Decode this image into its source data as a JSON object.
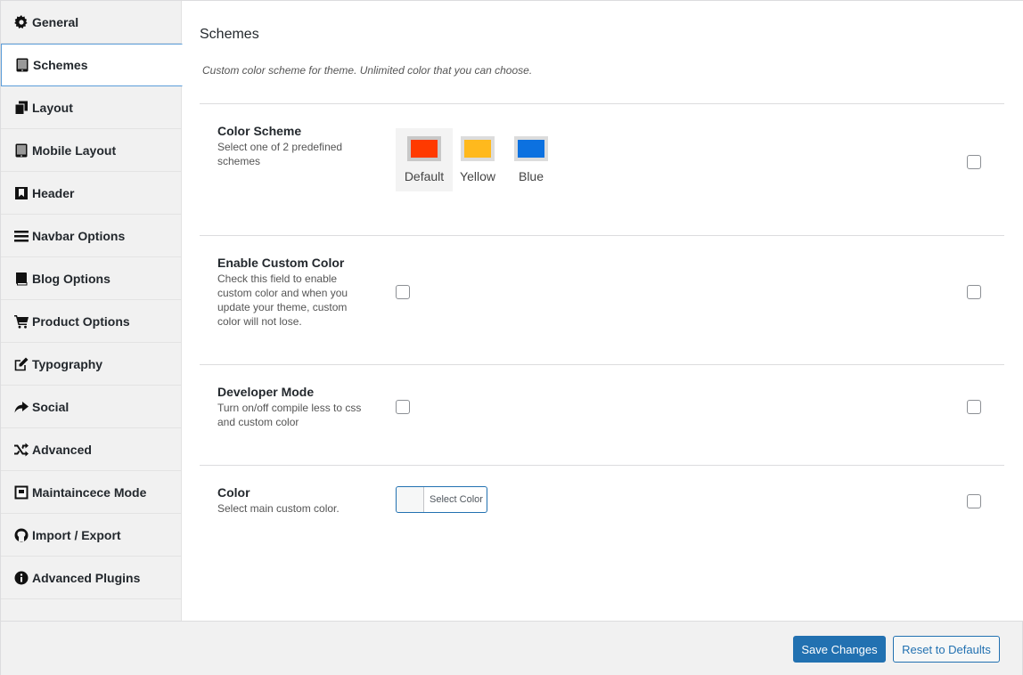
{
  "sidebar": {
    "items": [
      {
        "label": "General",
        "icon": "gear-icon"
      },
      {
        "label": "Schemes",
        "icon": "tablet-icon"
      },
      {
        "label": "Layout",
        "icon": "copy-icon"
      },
      {
        "label": "Mobile Layout",
        "icon": "tablet-icon"
      },
      {
        "label": "Header",
        "icon": "bookmark-icon"
      },
      {
        "label": "Navbar Options",
        "icon": "menu-icon"
      },
      {
        "label": "Blog Options",
        "icon": "book-icon"
      },
      {
        "label": "Product Options",
        "icon": "cart-icon"
      },
      {
        "label": "Typography",
        "icon": "edit-icon"
      },
      {
        "label": "Social",
        "icon": "share-icon"
      },
      {
        "label": "Advanced",
        "icon": "shuffle-icon"
      },
      {
        "label": "Maintaincece Mode",
        "icon": "inbox-icon"
      },
      {
        "label": "Import / Export",
        "icon": "github-icon"
      },
      {
        "label": "Advanced Plugins",
        "icon": "info-icon"
      }
    ],
    "active_index": 1
  },
  "main": {
    "title": "Schemes",
    "description": "Custom color scheme for theme. Unlimited color that you can choose.",
    "color_scheme": {
      "title": "Color Scheme",
      "desc": "Select one of 2 predefined schemes",
      "options": [
        {
          "name": "Default",
          "color": "#ff3a00"
        },
        {
          "name": "Yellow",
          "color": "#ffb91d"
        },
        {
          "name": "Blue",
          "color": "#0c71e0"
        }
      ]
    },
    "custom_color": {
      "title": "Enable Custom Color",
      "desc": "Check this field to enable custom color and when you update your theme, custom color will not lose."
    },
    "developer_mode": {
      "title": "Developer Mode",
      "desc": "Turn on/off compile less to css and custom color"
    },
    "color": {
      "title": "Color",
      "desc": "Select main custom color.",
      "button": "Select Color"
    }
  },
  "footer": {
    "save": "Save Changes",
    "reset": "Reset to Defaults"
  },
  "colors": {
    "primary": "#2271b1",
    "sidebar_bg": "#f1f1f1"
  }
}
